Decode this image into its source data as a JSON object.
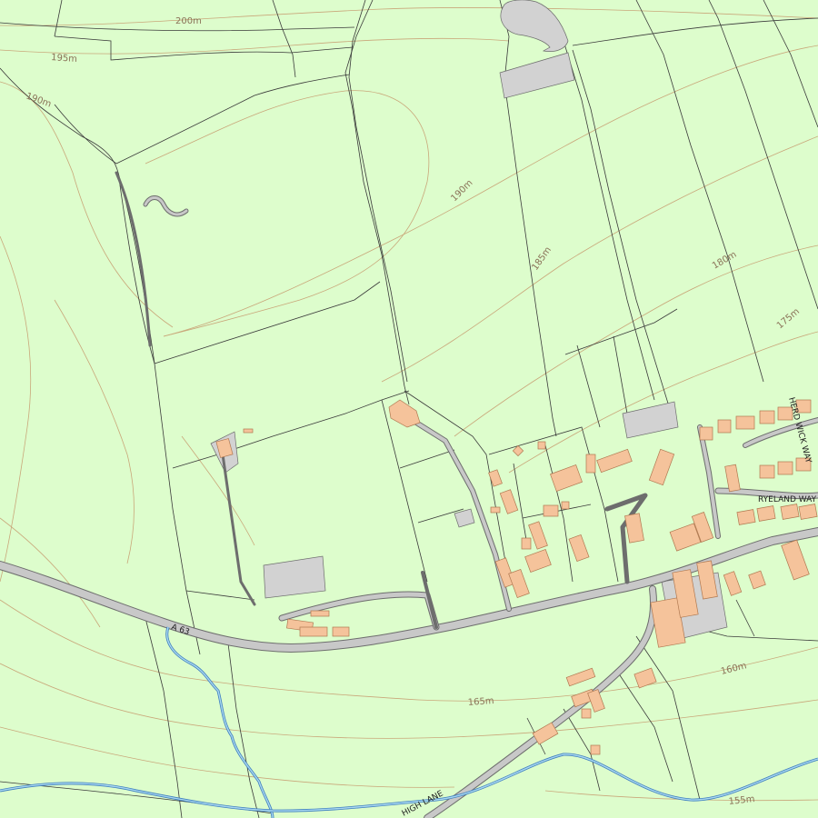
{
  "map": {
    "background_color": "#ddfdcc",
    "colors": {
      "field_boundary": "#3a3a3a",
      "contour": "#c9a77a",
      "road": "#c8c8c8",
      "building": "#f5c39b",
      "water": "#3f7fbf"
    },
    "contour_labels": [
      "200m",
      "195m",
      "190m",
      "190m",
      "185m",
      "180m",
      "175m",
      "165m",
      "160m",
      "155m"
    ],
    "road_labels": [
      "A 63",
      "RYELAND WAY",
      "HERD WICK WAY",
      "HIGH LANE"
    ]
  }
}
